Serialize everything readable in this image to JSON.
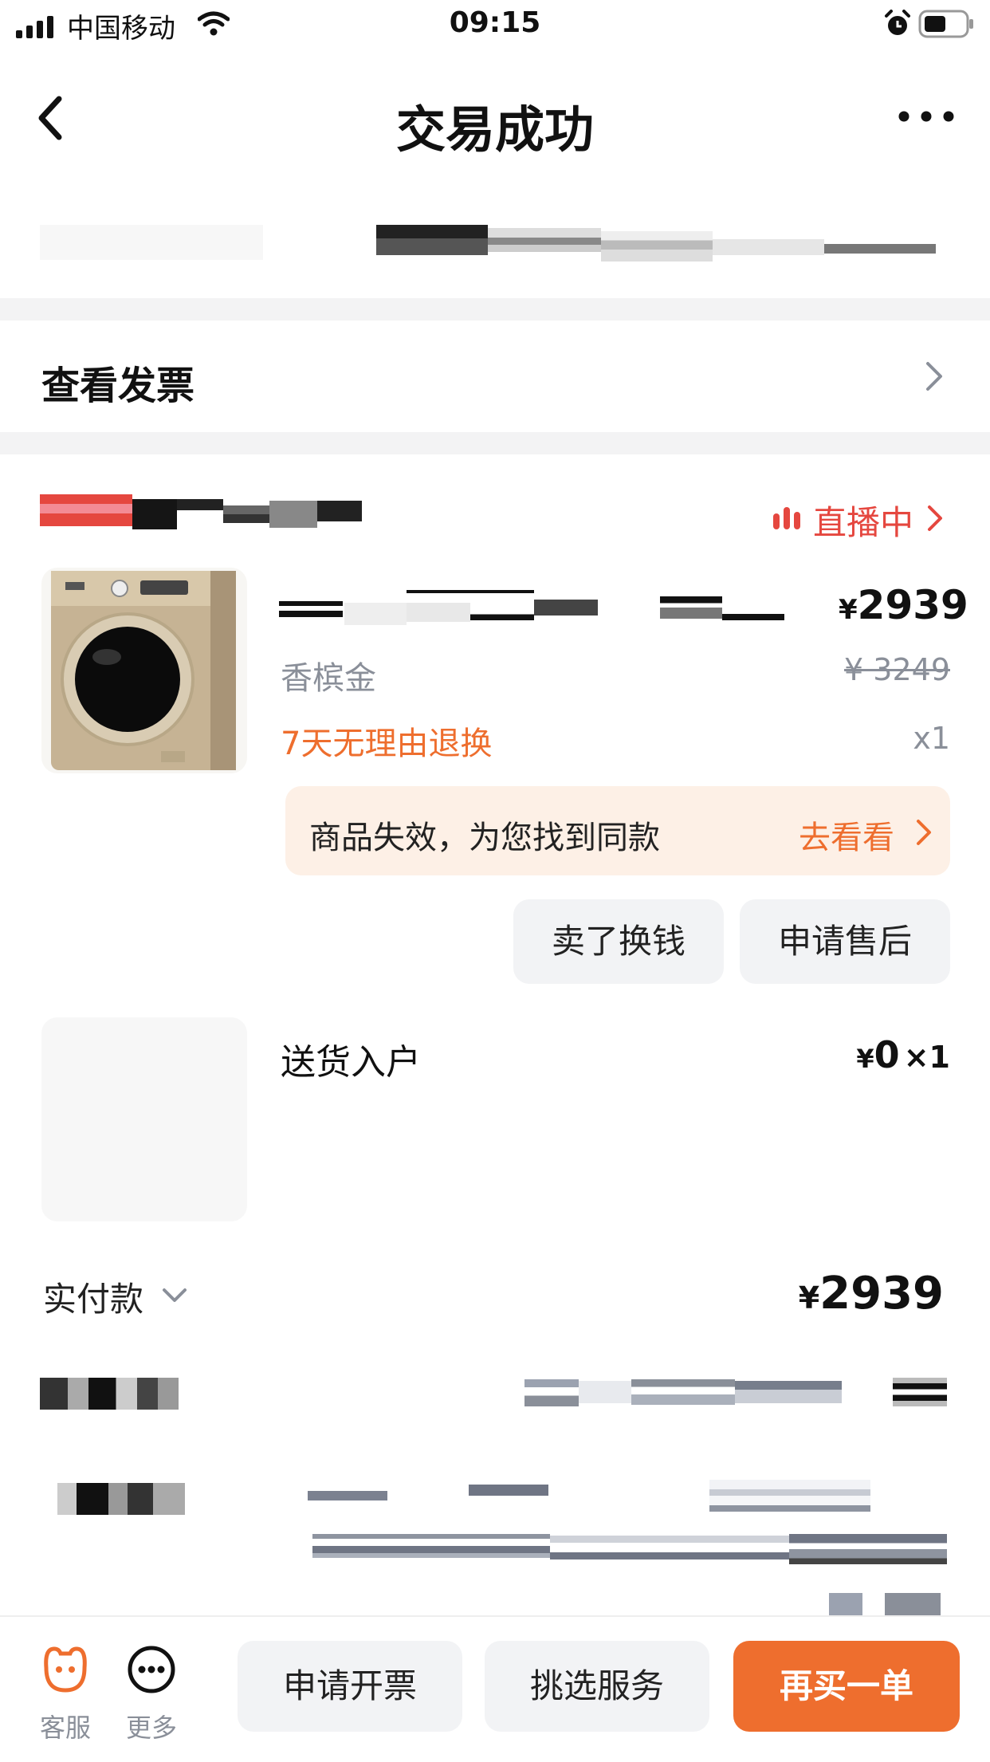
{
  "status_bar": {
    "carrier": "中国移动",
    "time": "09:15"
  },
  "nav": {
    "title": "交易成功"
  },
  "invoice_row": {
    "label": "查看发票"
  },
  "store": {
    "live_label": "直播中"
  },
  "product": {
    "price": "2939",
    "variant": "香槟金",
    "original_price": "¥ 3249",
    "return_policy": "7天无理由退换",
    "quantity": "x1",
    "notice_text": "商品失效，为您找到同款",
    "notice_action": "去看看",
    "sell_button": "卖了换钱",
    "aftersale_button": "申请售后"
  },
  "service_item": {
    "name": "送货入户",
    "price": "0",
    "quantity": "×1"
  },
  "payment": {
    "label": "实付款",
    "amount": "2939"
  },
  "bottom_bar": {
    "service_label": "客服",
    "more_label": "更多",
    "invoice_button": "申请开票",
    "service_button": "挑选服务",
    "rebuy_button": "再买一单"
  },
  "colors": {
    "accent": "#ee6e2e",
    "live_red": "#e5473f",
    "notice_bg": "#fdf0e6",
    "muted": "#8a8f99"
  }
}
